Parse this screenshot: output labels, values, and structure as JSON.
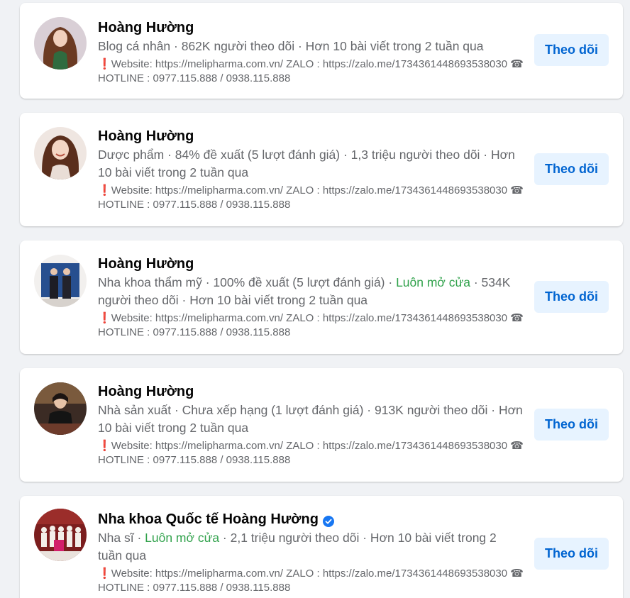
{
  "results": [
    {
      "name": "Hoàng Hường",
      "verified": false,
      "meta_parts": [
        {
          "text": "Blog cá nhân · 862K người theo dõi · Hơn 10 bài viết trong 2 tuần qua",
          "color": "gray"
        }
      ],
      "bio_mark": "❗",
      "bio": "Website: https://melipharma.com.vn/ ZALO : https://zalo.me/1734361448693538030 ☎ HOTLINE : 0977.115.888 / 0938.115.888",
      "follow_label": "Theo dõi",
      "avatar": "woman-long-hair-portrait"
    },
    {
      "name": "Hoàng Hường",
      "verified": false,
      "meta_parts": [
        {
          "text": "Dược phẩm · 84% đề xuất (5 lượt đánh giá) · 1,3 triệu người theo dõi · Hơn 10 bài viết trong 2 tuần qua",
          "color": "gray"
        }
      ],
      "bio_mark": "❗",
      "bio": "Website: https://melipharma.com.vn/ ZALO : https://zalo.me/1734361448693538030 ☎ HOTLINE : 0977.115.888 / 0938.115.888",
      "follow_label": "Theo dõi",
      "avatar": "woman-smiling-portrait"
    },
    {
      "name": "Hoàng Hường",
      "verified": false,
      "meta_parts": [
        {
          "text": "Nha khoa thẩm mỹ · 100% đề xuất (5 lượt đánh giá) · ",
          "color": "gray"
        },
        {
          "text": "Luôn mở cửa",
          "color": "green"
        },
        {
          "text": " · 534K người theo dõi · Hơn 10 bài viết trong 2 tuần qua",
          "color": "gray"
        }
      ],
      "bio_mark": "❗",
      "bio": "Website: https://melipharma.com.vn/ ZALO : https://zalo.me/1734361448693538030 ☎ HOTLINE : 0977.115.888 / 0938.115.888",
      "follow_label": "Theo dõi",
      "avatar": "two-people-in-suits"
    },
    {
      "name": "Hoàng Hường",
      "verified": false,
      "meta_parts": [
        {
          "text": "Nhà sản xuất · Chưa xếp hạng (1 lượt đánh giá) · 913K người theo dõi · Hơn 10 bài viết trong 2 tuần qua",
          "color": "gray"
        }
      ],
      "bio_mark": "❗",
      "bio": "Website: https://melipharma.com.vn/ ZALO : https://zalo.me/1734361448693538030 ☎ HOTLINE : 0977.115.888 / 0938.115.888",
      "follow_label": "Theo dõi",
      "avatar": "woman-seated-portrait"
    },
    {
      "name": "Nha khoa Quốc tế Hoàng Hường",
      "verified": true,
      "meta_parts": [
        {
          "text": "Nha sĩ · ",
          "color": "gray"
        },
        {
          "text": "Luôn mở cửa",
          "color": "green"
        },
        {
          "text": " · 2,1 triệu người theo dõi · Hơn 10 bài viết trong 2 tuần qua",
          "color": "gray"
        }
      ],
      "bio_mark": "❗",
      "bio": "Website: https://melipharma.com.vn/ ZALO : https://zalo.me/1734361448693538030 ☎ HOTLINE : 0977.115.888 / 0938.115.888",
      "follow_label": "Theo dõi",
      "avatar": "group-photo"
    }
  ],
  "colors": {
    "page_bg": "#f0f2f5",
    "card_bg": "#ffffff",
    "name_text": "#050505",
    "meta_text": "#65676b",
    "open_green": "#31a24c",
    "button_bg": "#e7f3ff",
    "button_text": "#0064d1",
    "verified_blue": "#1877f2"
  }
}
